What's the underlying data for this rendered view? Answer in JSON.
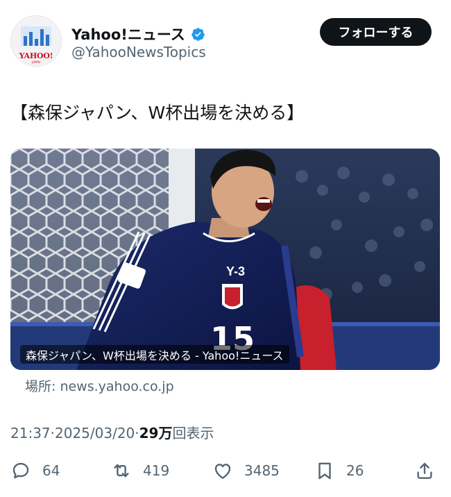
{
  "header": {
    "display_name": "Yahoo!ニュース",
    "handle": "@YahooNewsTopics",
    "follow_label": "フォローする",
    "avatar_logo": "YAHOO!",
    "avatar_logo_sub": "JAPAN"
  },
  "tweet": {
    "text": "【森保ジャパン、W杯出場を決める】"
  },
  "card": {
    "caption": "森保ジャパン、W杯出場を決める - Yahoo!ニュース",
    "source": "場所: news.yahoo.co.jp",
    "jersey_number": "15",
    "sponsor": "Y-3"
  },
  "meta": {
    "time": "21:37",
    "separator": " · ",
    "date": "2025/03/20",
    "views_number": "29万",
    "views_label": "回表示"
  },
  "actions": {
    "replies": "64",
    "retweets": "419",
    "likes": "3485",
    "bookmarks": "26"
  },
  "colors": {
    "text": "#0f1419",
    "secondary": "#536471",
    "verified": "#1d9bf0",
    "follow_bg": "#0f1419"
  }
}
